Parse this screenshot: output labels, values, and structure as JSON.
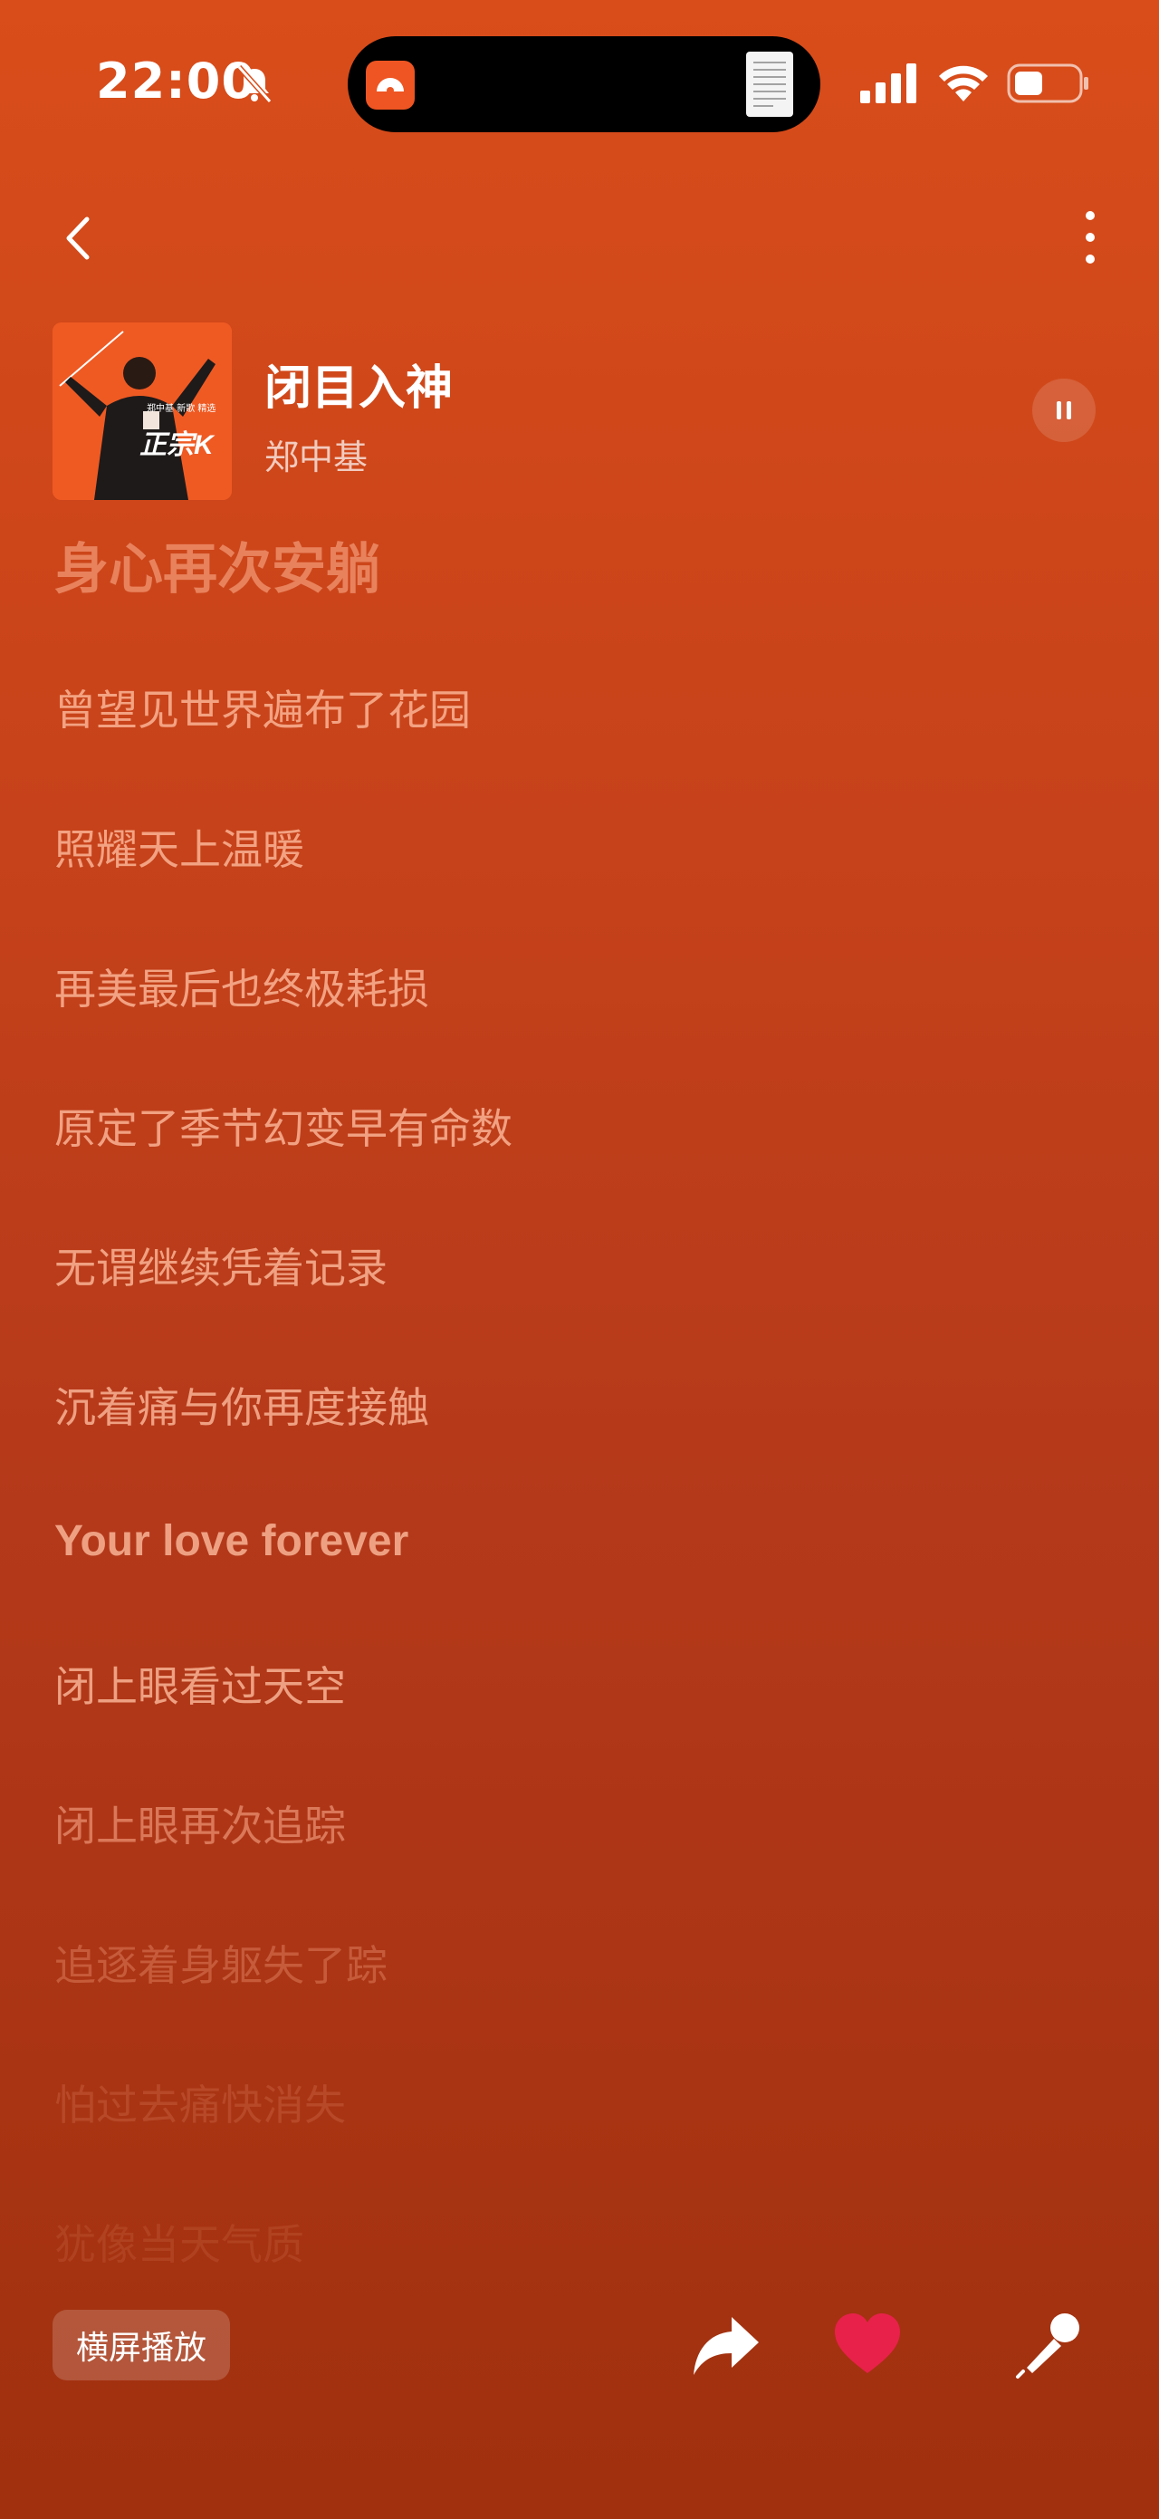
{
  "status_bar": {
    "time": "22:00",
    "icons": [
      "bell-slash-icon",
      "signal-icon",
      "wifi-icon",
      "battery-icon"
    ]
  },
  "nav": {
    "back_icon": "chevron-left-icon",
    "more_icon": "more-vertical-icon"
  },
  "song": {
    "title": "闭目入神",
    "artist": "郑中基",
    "cover_label": "正宗K",
    "cover_small_text": "郑中基 新歌 精选",
    "play_state_icon": "pause-icon"
  },
  "lyrics": [
    "身心再次安躺",
    "曾望见世界遍布了花园",
    "照耀天上温暖",
    "再美最后也终极耗损",
    "原定了季节幻变早有命数",
    "无谓继续凭着记录",
    "沉着痛与你再度接触",
    "Your love forever",
    "闭上眼看过天空",
    "闭上眼再次追踪",
    "追逐着身躯失了踪",
    "怕过去痛快消失",
    "犹像当天气质"
  ],
  "bottom_bar": {
    "landscape_label": "横屏播放",
    "share_icon": "share-arrow-icon",
    "like_icon": "heart-icon",
    "mic_icon": "microphone-icon"
  },
  "colors": {
    "background_top": "#d94d1a",
    "background_bottom": "#a0300e",
    "heart": "#e8214a"
  }
}
